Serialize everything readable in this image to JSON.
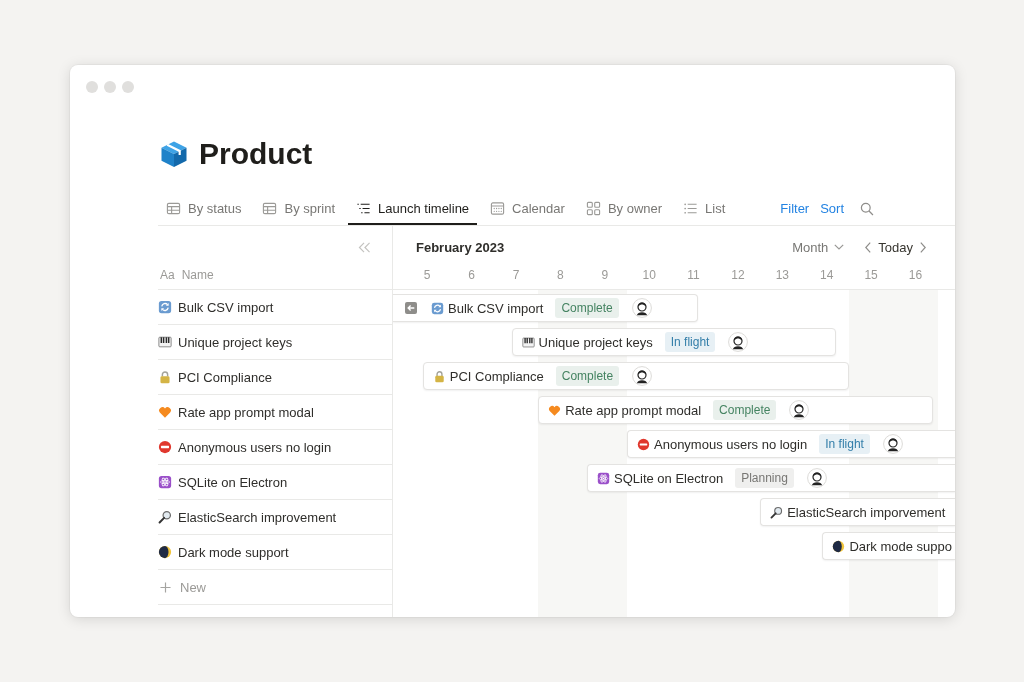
{
  "page": {
    "title": "Product"
  },
  "tabs": [
    {
      "label": "By status",
      "kind": "table",
      "selected": false
    },
    {
      "label": "By sprint",
      "kind": "table",
      "selected": false
    },
    {
      "label": "Launch timeline",
      "kind": "timeline",
      "selected": true
    },
    {
      "label": "Calendar",
      "kind": "calendar",
      "selected": false
    },
    {
      "label": "By owner",
      "kind": "board",
      "selected": false
    },
    {
      "label": "List",
      "kind": "list",
      "selected": false
    }
  ],
  "actions": [
    "Filter",
    "Sort"
  ],
  "table": {
    "header": {
      "type_glyph": "Aa",
      "label": "Name"
    },
    "rows": [
      {
        "name": "Bulk CSV import",
        "kind": "sync"
      },
      {
        "name": "Unique project keys",
        "kind": "piano"
      },
      {
        "name": "PCI Compliance",
        "kind": "lock"
      },
      {
        "name": "Rate app prompt modal",
        "kind": "heart"
      },
      {
        "name": "Anonymous users no login",
        "kind": "noentry"
      },
      {
        "name": "SQLite on Electron",
        "kind": "atom"
      },
      {
        "name": "ElasticSearch improvement",
        "kind": "magnifier"
      },
      {
        "name": "Dark mode support",
        "kind": "moon"
      }
    ],
    "new_label": "New"
  },
  "timeline": {
    "month": "February 2023",
    "scale": "Month",
    "today": "Today",
    "days": [
      {
        "label": "5",
        "shaded": false
      },
      {
        "label": "6",
        "shaded": false
      },
      {
        "label": "7",
        "shaded": false
      },
      {
        "label": "8",
        "shaded": true
      },
      {
        "label": "9",
        "shaded": true
      },
      {
        "label": "10",
        "shaded": false
      },
      {
        "label": "11",
        "shaded": false
      },
      {
        "label": "12",
        "shaded": false
      },
      {
        "label": "13",
        "shaded": false
      },
      {
        "label": "14",
        "shaded": false
      },
      {
        "label": "15",
        "shaded": true
      },
      {
        "label": "16",
        "shaded": true
      }
    ],
    "bars": [
      {
        "name": "Bulk CSV import",
        "kind": "sync",
        "status": {
          "label": "Complete",
          "color": "#448361"
        },
        "avatar": true
      },
      {
        "name": "Unique project keys",
        "kind": "piano",
        "status": {
          "label": "In flight",
          "color": "#337ea9"
        },
        "avatar": true
      },
      {
        "name": "PCI Compliance",
        "kind": "lock",
        "status": {
          "label": "Complete",
          "color": "#448361"
        },
        "avatar": true
      },
      {
        "name": "Rate app prompt modal",
        "kind": "heart",
        "status": {
          "label": "Complete",
          "color": "#448361"
        },
        "avatar": true
      },
      {
        "name": "Anonymous users no login",
        "kind": "noentry",
        "status": {
          "label": "In flight",
          "color": "#337ea9"
        },
        "avatar": true
      },
      {
        "name": "SQLite on Electron",
        "kind": "atom",
        "status": {
          "label": "Planning",
          "color": "#787774"
        },
        "avatar": true
      },
      {
        "name": "ElasticSearch imporvement",
        "kind": "magnifier"
      },
      {
        "name": "Dark mode suppo",
        "kind": "moon"
      }
    ]
  }
}
